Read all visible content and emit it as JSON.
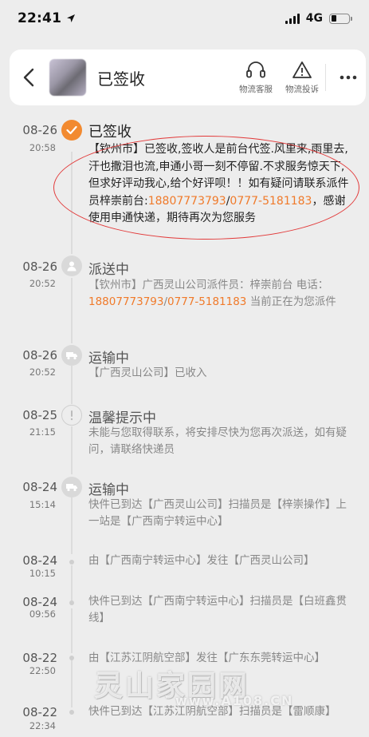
{
  "status_bar": {
    "time": "22:41",
    "network": "4G"
  },
  "header": {
    "title": "已签收",
    "service_label": "物流客服",
    "complaint_label": "物流投诉"
  },
  "events": [
    {
      "date": "08-26",
      "time": "20:58",
      "title": "已签收",
      "active": true,
      "body_parts": [
        {
          "text": "【钦州市】已签收,签收人是前台代签.风里来,雨里去,汗也撒泪也流,申通小哥一刻不停留.不求服务惊天下,但求好评动我心,给个好评呗！！如有疑问请联系派件员梓崇前台:"
        },
        {
          "text": "18807773793",
          "hl": true
        },
        {
          "text": "/"
        },
        {
          "text": "0777-5181183",
          "hl": true
        },
        {
          "text": "，感谢使用申通快递，期待再次为您服务"
        }
      ]
    },
    {
      "date": "08-26",
      "time": "20:52",
      "title": "派送中",
      "body_parts": [
        {
          "text": "【钦州市】广西灵山公司派件员：梓崇前台 电话："
        },
        {
          "text": "18807773793",
          "hl": true
        },
        {
          "text": "/"
        },
        {
          "text": "0777-5181183",
          "hl": true
        },
        {
          "text": " 当前正在为您派件"
        }
      ]
    },
    {
      "date": "08-26",
      "time": "20:52",
      "title": "运输中",
      "body_parts": [
        {
          "text": "【广西灵山公司】已收入"
        }
      ]
    },
    {
      "date": "08-25",
      "time": "21:15",
      "title": "温馨提示中",
      "body_parts": [
        {
          "text": "未能与您取得联系，将安排尽快为您再次派送，如有疑问，请联络快递员"
        }
      ]
    },
    {
      "date": "08-24",
      "time": "15:14",
      "title": "运输中",
      "body_parts": [
        {
          "text": "快件已到达【广西灵山公司】扫描员是【梓崇操作】上一站是【广西南宁转运中心】"
        }
      ]
    },
    {
      "date": "08-24",
      "time": "10:15",
      "body_parts": [
        {
          "text": "由【广西南宁转运中心】发往【广西灵山公司】"
        }
      ]
    },
    {
      "date": "08-24",
      "time": "09:56",
      "body_parts": [
        {
          "text": "快件已到达【广西南宁转运中心】扫描员是【白班鑫贯线】"
        }
      ]
    },
    {
      "date": "08-22",
      "time": "22:50",
      "body_parts": [
        {
          "text": "由【江苏江阴航空部】发往【广东东莞转运中心】"
        }
      ]
    },
    {
      "date": "08-22",
      "time": "22:34",
      "body_parts": [
        {
          "text": "快件已到达【江苏江阴航空部】扫描员是【雷顺康】"
        }
      ]
    }
  ],
  "watermark": {
    "main": "灵山家园网",
    "sub": "www.A108.CN"
  }
}
